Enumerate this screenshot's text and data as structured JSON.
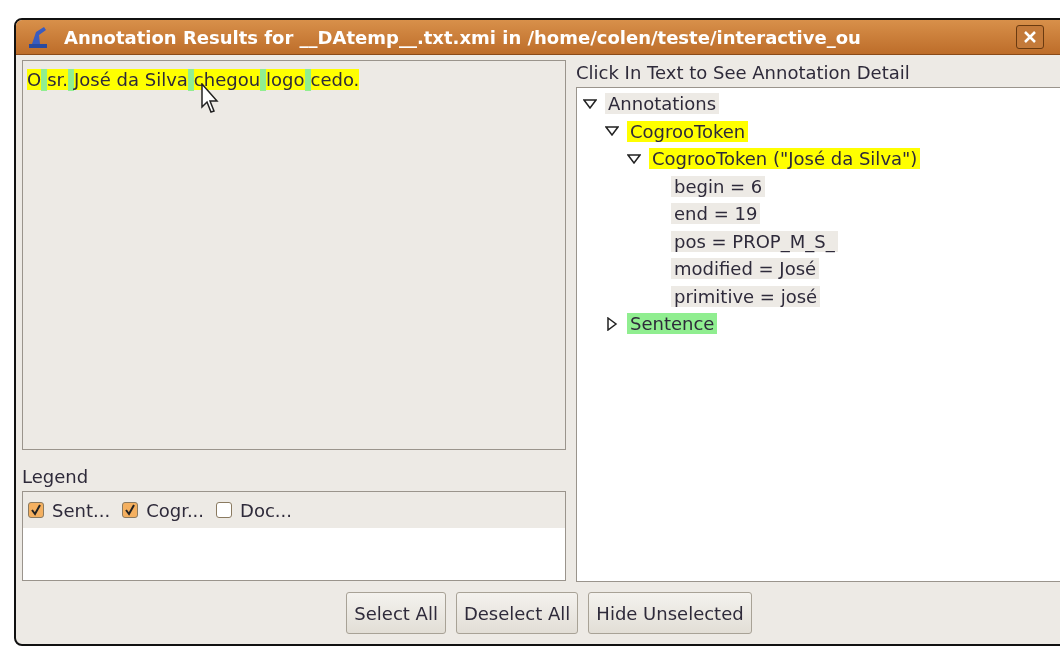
{
  "window": {
    "title": "Annotation Results for __DAtemp__.txt.xmi in /home/colen/teste/interactive_ou"
  },
  "document": {
    "segments": [
      {
        "kind": "token",
        "text": "O",
        "color": "#ffff00"
      },
      {
        "kind": "gap",
        "color": "#90ee90"
      },
      {
        "kind": "token",
        "text": "sr.",
        "color": "#ffff00"
      },
      {
        "kind": "gap",
        "color": "#90ee90"
      },
      {
        "kind": "token",
        "text": "José da Silva",
        "color": "#ffff00"
      },
      {
        "kind": "gap",
        "color": "#90ee90"
      },
      {
        "kind": "token",
        "text": "chegou",
        "color": "#ffff00"
      },
      {
        "kind": "gap",
        "color": "#90ee90"
      },
      {
        "kind": "token",
        "text": "logo",
        "color": "#ffff00"
      },
      {
        "kind": "gap",
        "color": "#90ee90"
      },
      {
        "kind": "token",
        "text": "cedo.",
        "color": "#ffff00"
      }
    ]
  },
  "detail_label": "Click In Text to See Annotation Detail",
  "tree": [
    {
      "label": "Annotations",
      "expanded": true,
      "children": [
        {
          "label": "CogrooToken",
          "color": "#ffff00",
          "expanded": true,
          "children": [
            {
              "label": "CogrooToken (\"José da Silva\")",
              "color": "#ffff00",
              "expanded": true,
              "children": [
                {
                  "label": "begin = 6"
                },
                {
                  "label": "end = 19"
                },
                {
                  "label": "pos = PROP_M_S_"
                },
                {
                  "label": "modified = José"
                },
                {
                  "label": "primitive = josé"
                }
              ]
            }
          ]
        },
        {
          "label": "Sentence",
          "color": "#90ee90",
          "expanded": false
        }
      ]
    }
  ],
  "legend": {
    "title": "Legend",
    "items": [
      {
        "label": "Sent...",
        "checked": true
      },
      {
        "label": "Cogr...",
        "checked": true
      },
      {
        "label": "Doc...",
        "checked": false
      }
    ]
  },
  "buttons": [
    "Select All",
    "Deselect All",
    "Hide Unselected"
  ]
}
